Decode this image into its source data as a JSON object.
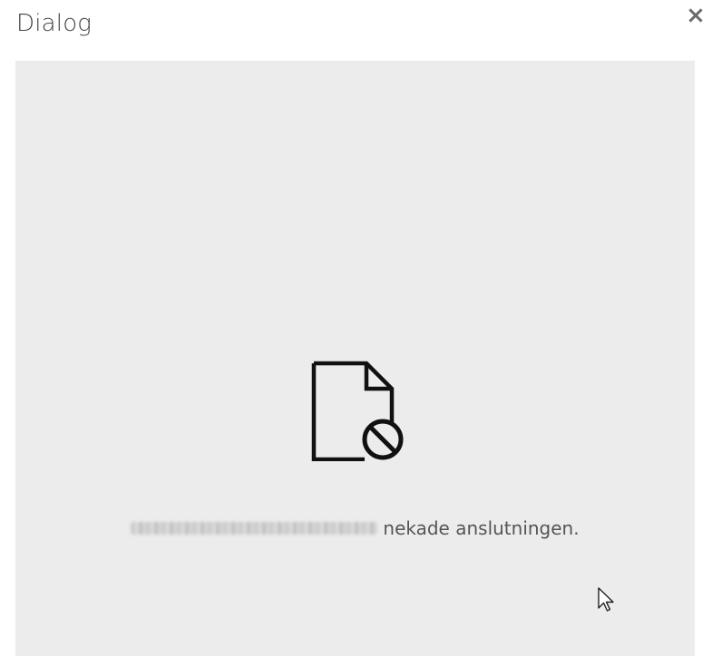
{
  "dialog": {
    "title": "Dialog",
    "close_icon": "close-icon"
  },
  "content": {
    "icon": "blocked-file-icon",
    "redacted_host_name": "",
    "message_suffix": "nekade anslutningen.",
    "background_color": "#ececec"
  },
  "cursor": {
    "icon": "mouse-pointer-icon"
  }
}
